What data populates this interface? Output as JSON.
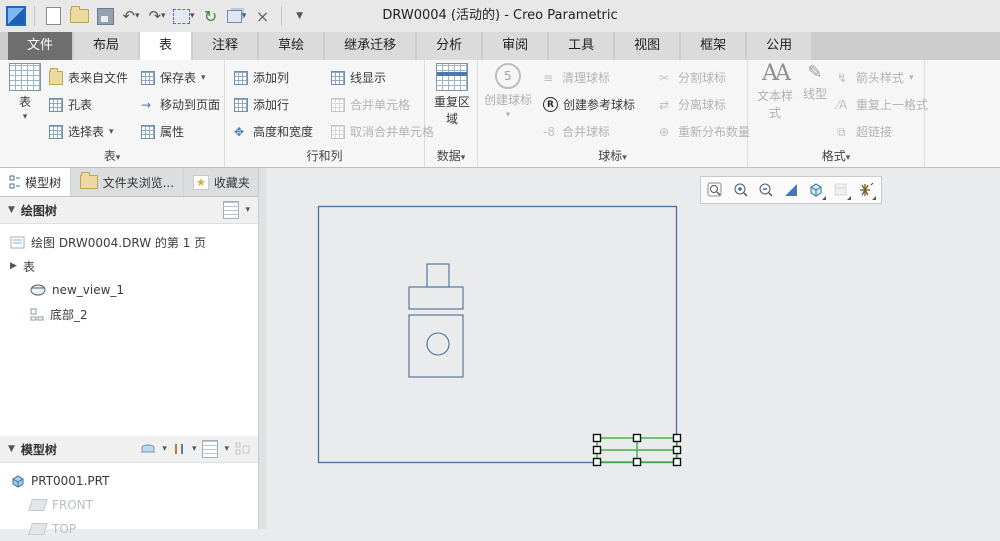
{
  "colors": {
    "selection_green": "#3cb43c",
    "drawing_line_blue": "#4a6f99",
    "file_tab_gray": "#6e6e6e"
  },
  "title_bar": {
    "title": "DRW0004 (活动的) - Creo Parametric"
  },
  "ribbon_tabs": {
    "file": "文件",
    "layout": "布局",
    "table": "表",
    "annotate": "注释",
    "sketch": "草绘",
    "legacy": "继承迁移",
    "analysis": "分析",
    "review": "审阅",
    "tools": "工具",
    "view": "视图",
    "framework": "框架",
    "common": "公用"
  },
  "ribbon": {
    "table_group": {
      "big": "表",
      "from_file": "表来自文件",
      "hole_table": "孔表",
      "select_table": "选择表",
      "save_table": "保存表",
      "move_to_page": "移动到页面",
      "properties": "属性",
      "label": "表"
    },
    "rows_group": {
      "add_col": "添加列",
      "add_row": "添加行",
      "height_width": "高度和宽度",
      "line_display": "线显示",
      "merge_cells": "合并单元格",
      "unmerge_cells": "取消合并单元格",
      "label": "行和列"
    },
    "data_group": {
      "big": "重复区域",
      "label": "数据"
    },
    "balloon_group": {
      "big": "创建球标",
      "clean": "清理球标",
      "create_ref": "创建参考球标",
      "merge": "合并球标",
      "split": "分割球标",
      "detach": "分离球标",
      "redistribute": "重新分布数量",
      "label": "球标"
    },
    "format_group": {
      "text_style": "文本样式",
      "line_style": "线型",
      "arrow_style": "箭头样式",
      "repeat_format": "重复上一格式",
      "hyperlink": "超链接",
      "label": "格式"
    }
  },
  "left_panel": {
    "tab_model_tree": "模型树",
    "tab_folder_browser": "文件夹浏览...",
    "tab_favorites": "收藏夹",
    "drawing_tree": {
      "header": "绘图树",
      "page_item": "绘图 DRW0004.DRW 的第 1 页",
      "table_item": "表",
      "view_item": "new_view_1",
      "bottom_item": "底部_2"
    },
    "model_tree": {
      "header": "模型树",
      "part_item": "PRT0001.PRT",
      "front_item": "FRONT",
      "top_item": "TOP"
    }
  }
}
